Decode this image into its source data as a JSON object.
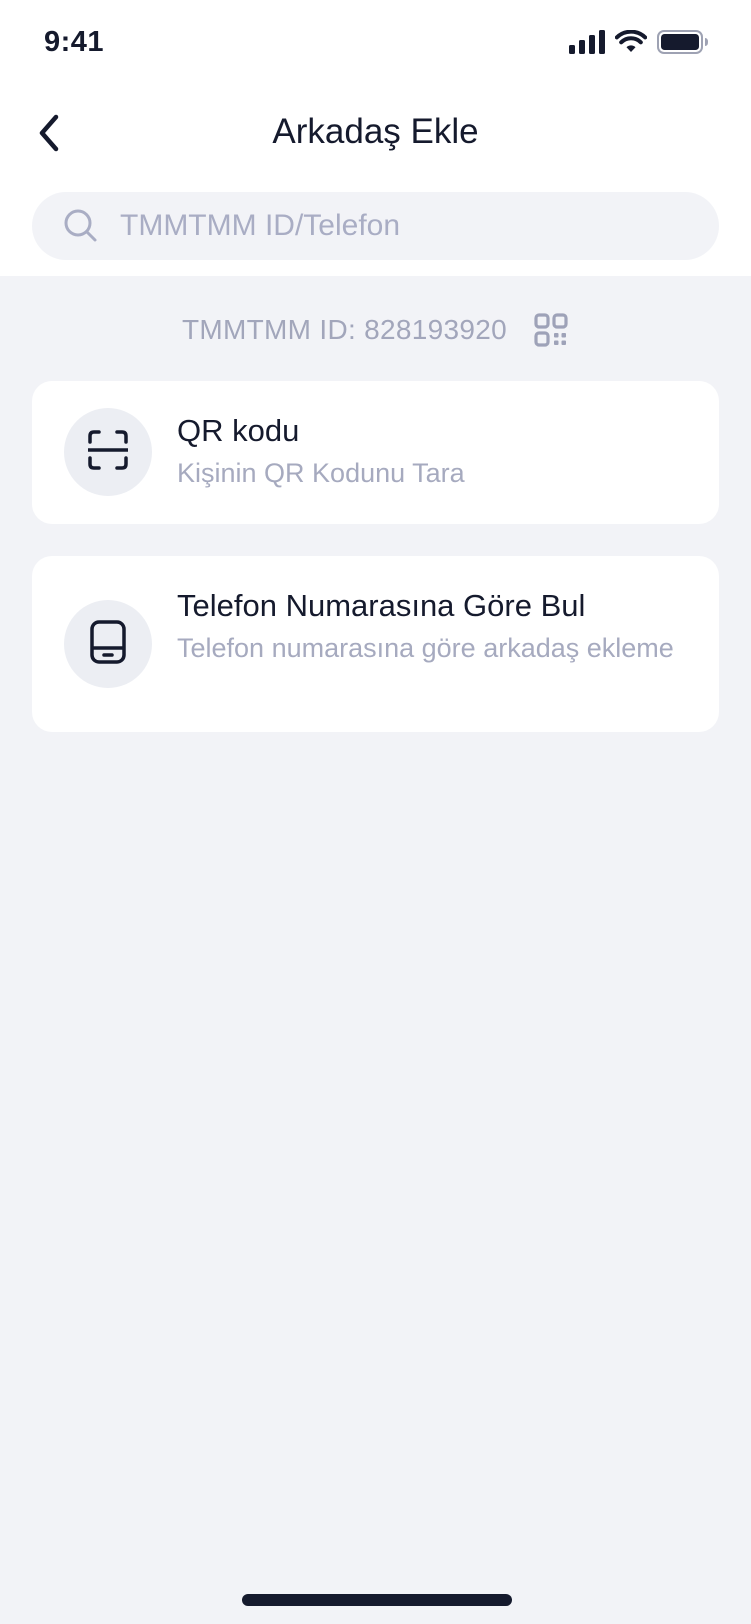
{
  "status_bar": {
    "time": "9:41",
    "icons": [
      "signal-icon",
      "wifi-icon",
      "battery-icon"
    ]
  },
  "header": {
    "back_icon": "chevron-left-icon",
    "title": "Arkadaş Ekle"
  },
  "search": {
    "icon": "search-icon",
    "placeholder": "TMMTMM ID/Telefon",
    "value": ""
  },
  "my_id": {
    "text": "TMMTMM ID: 828193920",
    "icon": "qr-code-icon"
  },
  "options": [
    {
      "icon": "scan-icon",
      "title": "QR kodu",
      "subtitle": "Kişinin QR Kodunu Tara"
    },
    {
      "icon": "phone-icon",
      "title": "Telefon Numarasına Göre Bul",
      "subtitle": "Telefon numarasına göre arkadaş ekleme"
    }
  ],
  "colors": {
    "background": "#f2f3f7",
    "surface": "#ffffff",
    "text_primary": "#151a2d",
    "text_secondary": "#a6aabf",
    "icon_circle": "#eceef3"
  }
}
